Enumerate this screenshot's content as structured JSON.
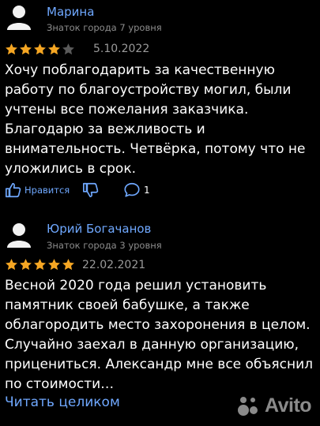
{
  "reviews": [
    {
      "author": "Марина",
      "level": "Знаток города 7 уровня",
      "rating": 4,
      "date": "5.10.2022",
      "text": "Хочу поблагодарить за качественную работу по благоустройству могил, были учтены все пожелания заказчика. Благодарю за вежливость и внимательность. Четвёрка, потому что не уложились в срок.",
      "like_label": "Нравится",
      "comment_count": "1"
    },
    {
      "author": "Юрий Богачанов",
      "level": "Знаток города 3 уровня",
      "rating": 5,
      "date": "22.02.2021",
      "text": "Весной 2020 года решил установить памятник своей бабушке, а также облагородить место захоронения в целом. Случайно заехал в данную организацию, прицениться. Александр мне все объяснил по стоимости…"
    }
  ],
  "read_more": "Читать целиком",
  "watermark": "Avito",
  "colors": {
    "star": "#f5a623",
    "link": "#6fa8ff",
    "secondary": "#8c8c8c",
    "background": "#000000"
  }
}
